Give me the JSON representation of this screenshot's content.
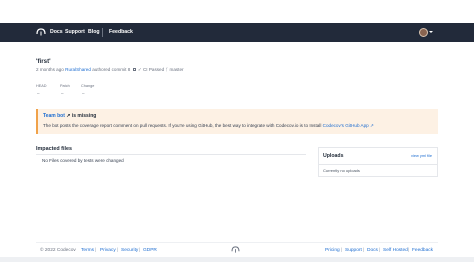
{
  "nav": {
    "items": [
      "Docs",
      "Support",
      "Blog",
      "Feedback"
    ]
  },
  "commit": {
    "title": "'first'",
    "time_prefix": "2 months ago",
    "author": "RuralShared",
    "authored_text": "authored commit",
    "commit_id": "8",
    "ci_status": "CI Passed",
    "branch": "master"
  },
  "stats": [
    {
      "label": "HEAD",
      "value": "–"
    },
    {
      "label": "Patch",
      "value": "–"
    },
    {
      "label": "Change",
      "value": "–"
    }
  ],
  "alert": {
    "link_text": "Team bot",
    "title_suffix": "is missing",
    "body_prefix": "The bot posts the coverage report comment on pull requests. If you're using GitHub, the best way to integrate with Codecov.io is to Install",
    "body_link": "Codecov's GitHub App"
  },
  "impacted": {
    "title": "Impacted files",
    "empty_text": "No Files covered by tests were changed"
  },
  "uploads": {
    "title": "Uploads",
    "link_text": "view yml file",
    "empty_text": "Currently no uploads"
  },
  "footer": {
    "copyright": "© 2022 Codecov",
    "left_links": [
      "Terms",
      "Privacy",
      "Security",
      "GDPR"
    ],
    "right_links": [
      "Pricing",
      "Support",
      "Docs",
      "Self Hosted",
      "Feedback"
    ]
  },
  "colors": {
    "topbar": "#222a3a",
    "link": "#1d6dd1",
    "alert_bg": "#fdf1e4",
    "alert_border": "#f0a24a"
  }
}
